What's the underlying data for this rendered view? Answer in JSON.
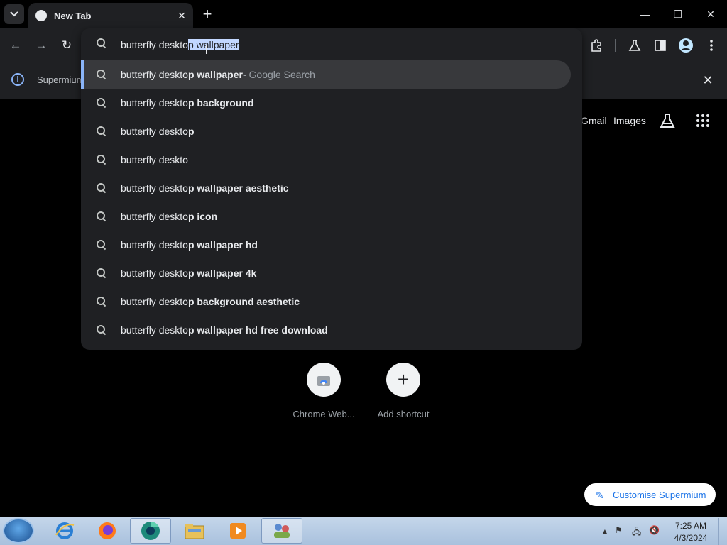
{
  "tab": {
    "title": "New Tab",
    "close": "✕"
  },
  "window": {
    "minimize": "—",
    "restore": "❐",
    "close": "✕",
    "new_tab": "+"
  },
  "toolbar": {
    "back": "←",
    "forward": "→",
    "reload": "↻"
  },
  "infobar": {
    "text": "Supermium",
    "close": "✕"
  },
  "ntp": {
    "gmail": "Gmail",
    "images": "Images"
  },
  "omnibox": {
    "typed_prefix": "butterfly deskto",
    "autocomplete": "p wallpaper",
    "suggestions": [
      {
        "plain": "butterfly deskto",
        "bold": "p wallpaper",
        "suffix": " - Google Search"
      },
      {
        "plain": "butterfly deskto",
        "bold": "p background",
        "suffix": ""
      },
      {
        "plain": "butterfly deskto",
        "bold": "p",
        "suffix": ""
      },
      {
        "plain": "butterfly deskto",
        "bold": "",
        "suffix": ""
      },
      {
        "plain": "butterfly deskto",
        "bold": "p wallpaper aesthetic",
        "suffix": ""
      },
      {
        "plain": "butterfly deskto",
        "bold": "p icon",
        "suffix": ""
      },
      {
        "plain": "butterfly deskto",
        "bold": "p wallpaper hd",
        "suffix": ""
      },
      {
        "plain": "butterfly deskto",
        "bold": "p wallpaper 4k",
        "suffix": ""
      },
      {
        "plain": "butterfly deskto",
        "bold": "p background aesthetic",
        "suffix": ""
      },
      {
        "plain": "butterfly deskto",
        "bold": "p wallpaper hd free download",
        "suffix": ""
      }
    ]
  },
  "shortcuts": [
    {
      "label": "Chrome Web..."
    },
    {
      "label": "Add shortcut",
      "icon": "+"
    }
  ],
  "customise": {
    "label": "Customise Supermium",
    "icon": "✎"
  },
  "taskbar": {
    "time": "7:25 AM",
    "date": "4/3/2024"
  },
  "colors": {
    "accent": "#8ab4f8",
    "omnibox_bg": "#1f2023",
    "selection": "#c2d7ff"
  }
}
